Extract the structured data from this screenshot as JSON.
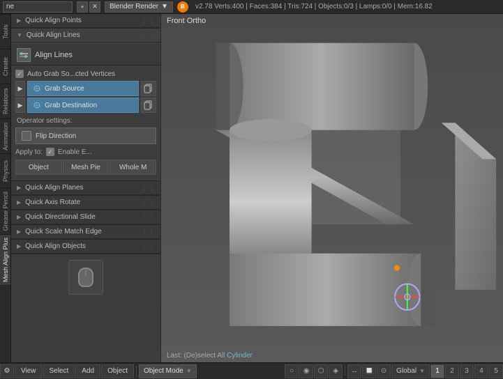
{
  "topbar": {
    "scene_name": "ne",
    "render_engine": "Blender Render",
    "version": "v2.78",
    "stats": "Verts:400 | Faces:384 | Tris:724 | Objects:0/3 | Lamps:0/0 | Mem:16.82"
  },
  "vertical_tabs": [
    {
      "id": "tools",
      "label": "Tools"
    },
    {
      "id": "create",
      "label": "Create"
    },
    {
      "id": "relations",
      "label": "Relations"
    },
    {
      "id": "animation",
      "label": "Animation"
    },
    {
      "id": "physics",
      "label": "Physics"
    },
    {
      "id": "grease-pencil",
      "label": "Grease Pencil"
    },
    {
      "id": "mesh-align-plus",
      "label": "Mesh Align Plus"
    }
  ],
  "sidebar": {
    "sections": [
      {
        "label": "Quick Align Points",
        "expanded": false
      },
      {
        "label": "Quick Align Lines",
        "expanded": true
      }
    ],
    "align_lines": {
      "header_label": "Align Lines",
      "auto_grab_label": "Auto Grab So...cted Vertices",
      "grab_source_label": "Grab Source",
      "grab_destination_label": "Grab Destination",
      "operator_label": "Operator settings:",
      "flip_direction_label": "Flip Direction",
      "apply_to_label": "Apply to:",
      "enable_e_label": "Enable E...",
      "buttons": [
        "Object",
        "Mesh Pie",
        "Whole M"
      ]
    },
    "collapsible": [
      {
        "label": "Quick Align Planes"
      },
      {
        "label": "Quick Axis Rotate"
      },
      {
        "label": "Quick Directional Slide"
      },
      {
        "label": "Quick Scale Match Edge"
      },
      {
        "label": "Quick Align Objects"
      }
    ]
  },
  "viewport": {
    "label": "Front Ortho"
  },
  "last_op": {
    "prefix": "Last:",
    "op_text": "(De)select All",
    "highlight": "Cylinder"
  },
  "bottombar": {
    "mode_label": "Object Mode",
    "global_label": "Global",
    "buttons": [
      "⚙",
      "View",
      "Select",
      "Add",
      "Object"
    ]
  },
  "icons": {
    "arrow_right": "▶",
    "arrow_down": "▼",
    "drag": "⋮⋮",
    "checkmark": "✓",
    "plus": "+",
    "cross": "✕",
    "copy": "⎘",
    "dot": "●"
  }
}
